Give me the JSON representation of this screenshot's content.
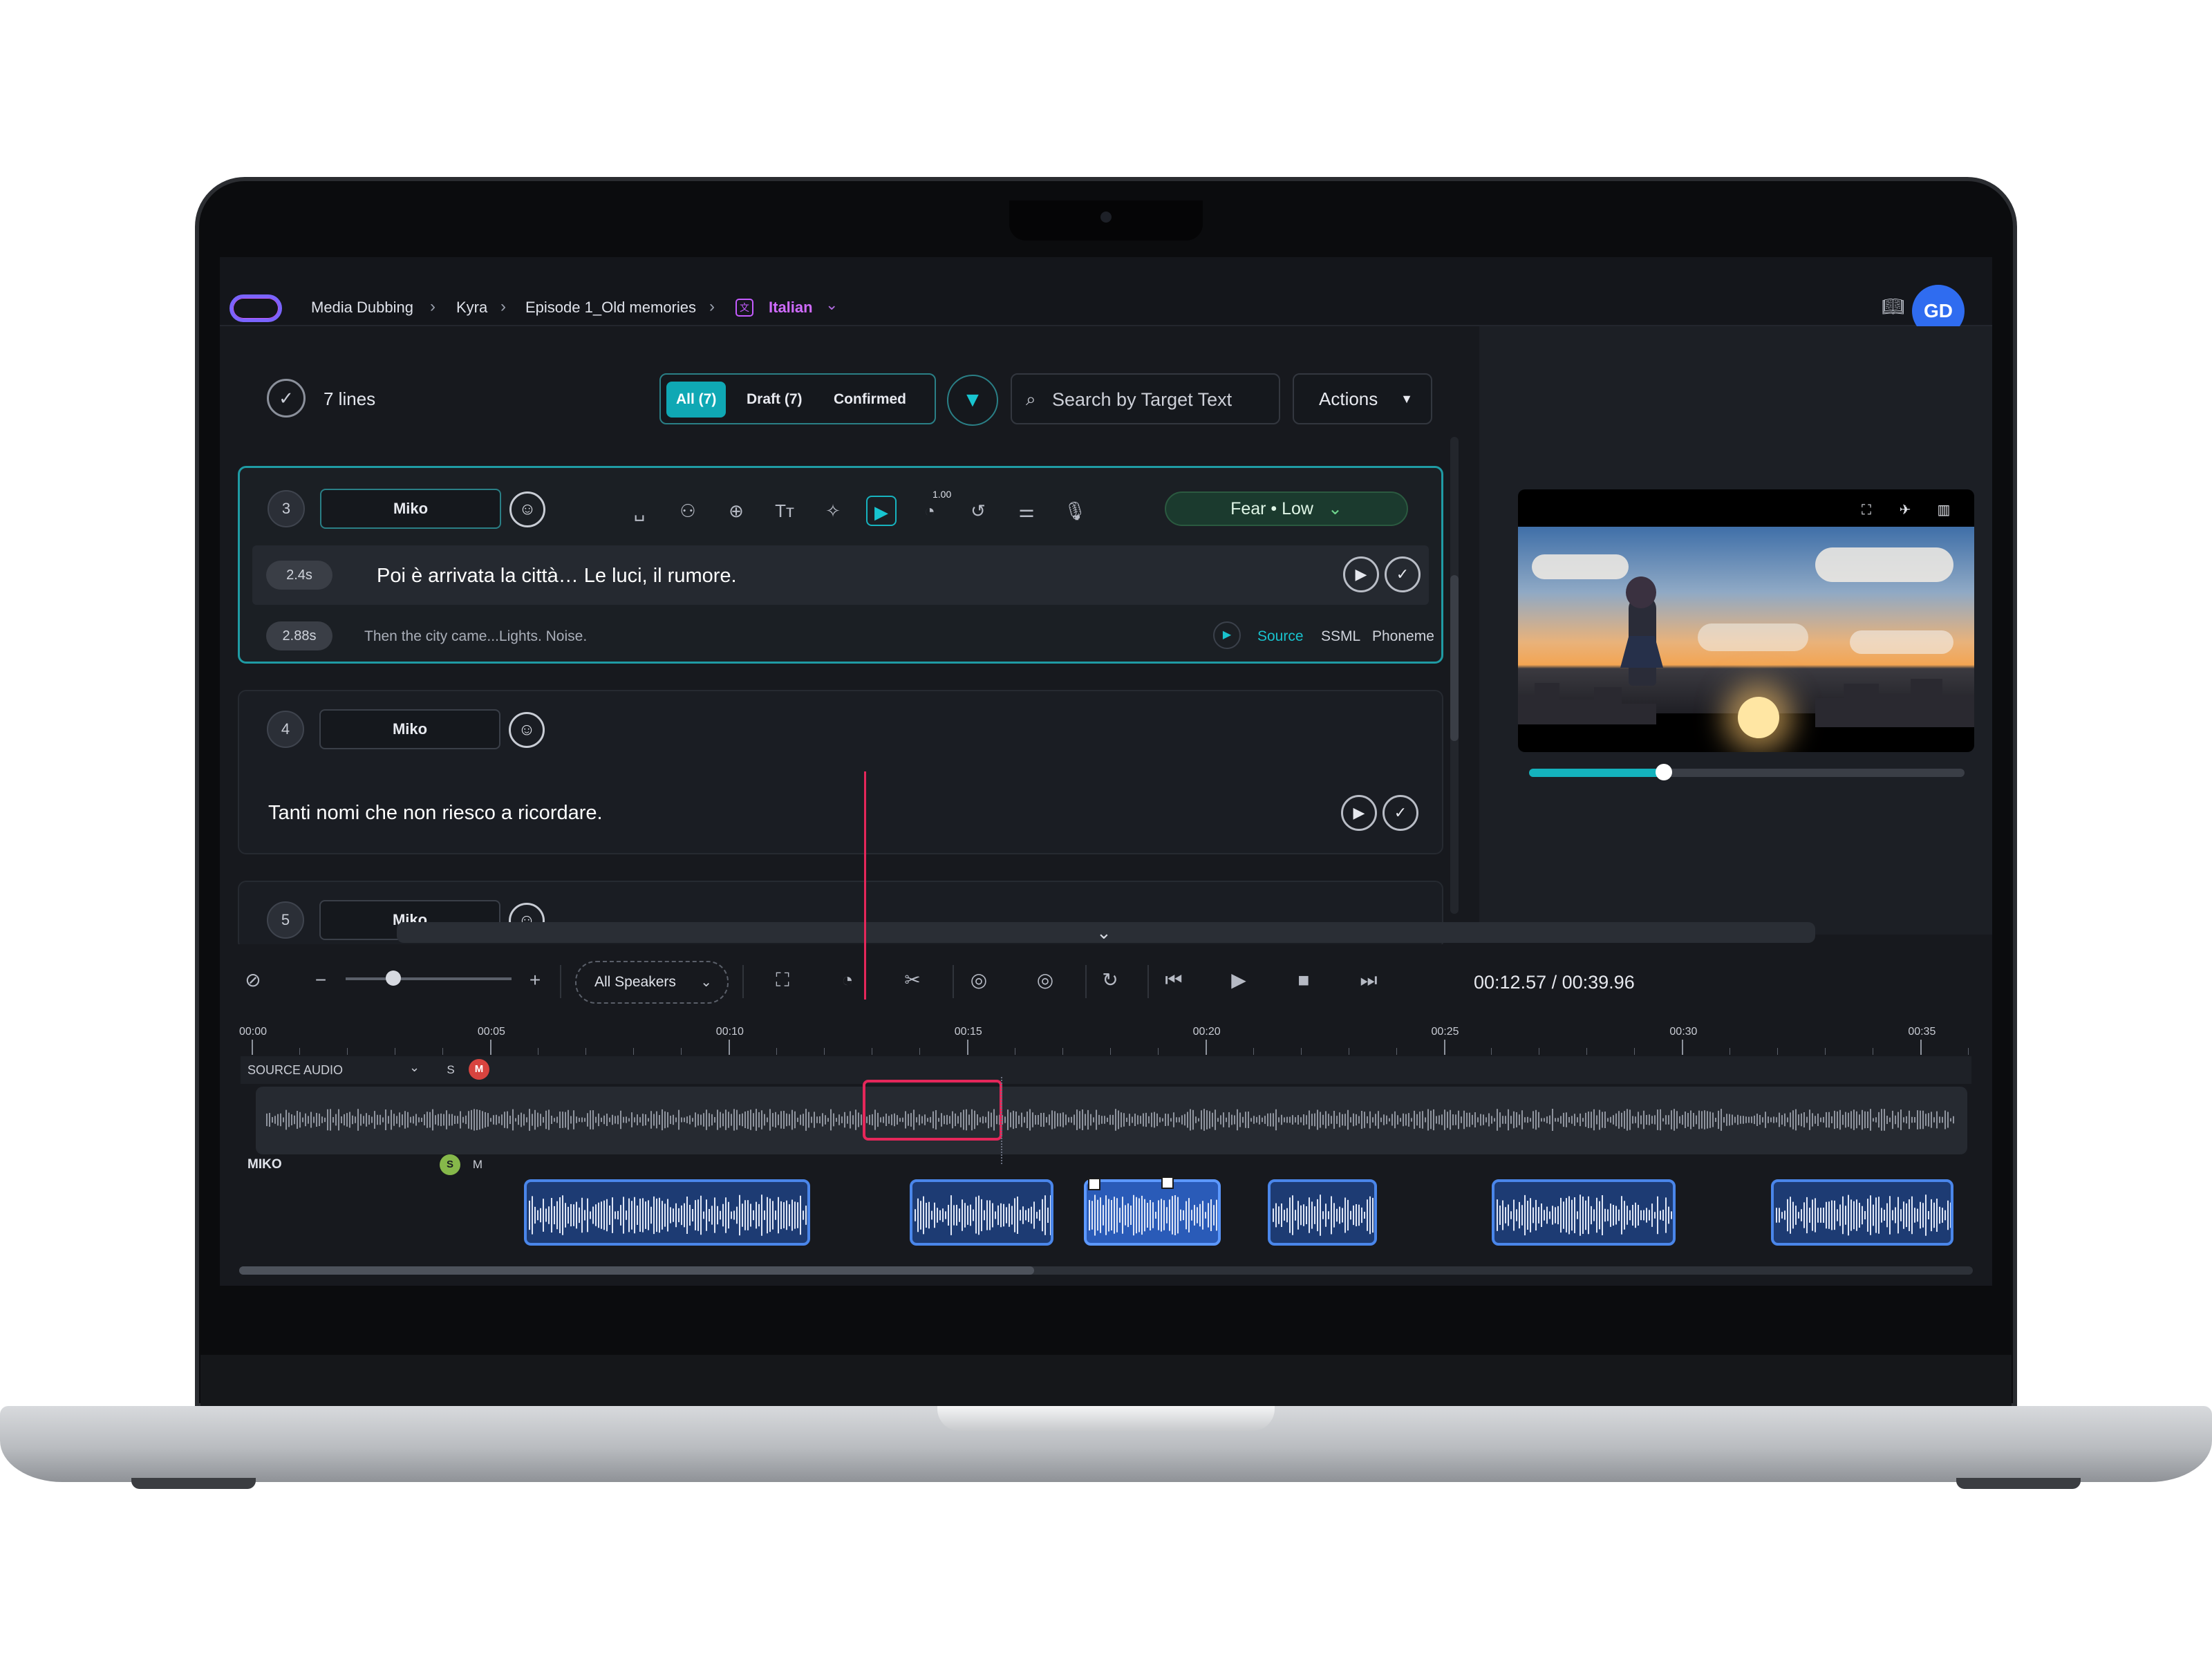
{
  "breadcrumb": [
    "Media Dubbing",
    "Kyra",
    "Episode 1_Old memories"
  ],
  "language": {
    "label": "Italian",
    "icon": "language-icon"
  },
  "user": {
    "initials": "GD"
  },
  "list_toolbar": {
    "lines_count": "7 lines",
    "tabs": [
      {
        "label": "All (7)",
        "active": true
      },
      {
        "label": "Draft (7)",
        "active": false
      },
      {
        "label": "Confirmed",
        "active": false
      }
    ],
    "search_placeholder": "Search by Target Text",
    "actions_label": "Actions"
  },
  "lines": [
    {
      "number": "3",
      "speaker": "Miko",
      "target_duration": "2.4s",
      "target_text": "Poi è arrivata la città… Le luci, il rumore.",
      "source_duration": "2.88s",
      "source_text": "Then the city came...Lights. Noise.",
      "emotion": "Fear • Low",
      "speed_badge": "1.00",
      "source_options": [
        "Source",
        "SSML",
        "Phoneme"
      ]
    },
    {
      "number": "4",
      "speaker": "Miko",
      "target_text": "Tanti nomi che non riesco a ricordare."
    },
    {
      "number": "5",
      "speaker": "Miko"
    }
  ],
  "video": {
    "progress": 0.31
  },
  "timeline": {
    "speaker_filter": "All Speakers",
    "timecode": "00:12.57 / 00:39.96",
    "ticks": [
      "00:00",
      "00:05",
      "00:10",
      "00:15",
      "00:20",
      "00:25",
      "00:30",
      "00:35"
    ],
    "source_track": {
      "label": "SOURCE AUDIO",
      "solo": "S",
      "mute": "M"
    },
    "speaker_track": {
      "label": "MIKO",
      "solo": "S",
      "mute": "M"
    },
    "zoom_level": 0.25
  },
  "colors": {
    "accent": "#0fa8b4",
    "playhead": "#e5275a",
    "clip": "#4a86ea",
    "emotion": "#1b3a2e"
  }
}
